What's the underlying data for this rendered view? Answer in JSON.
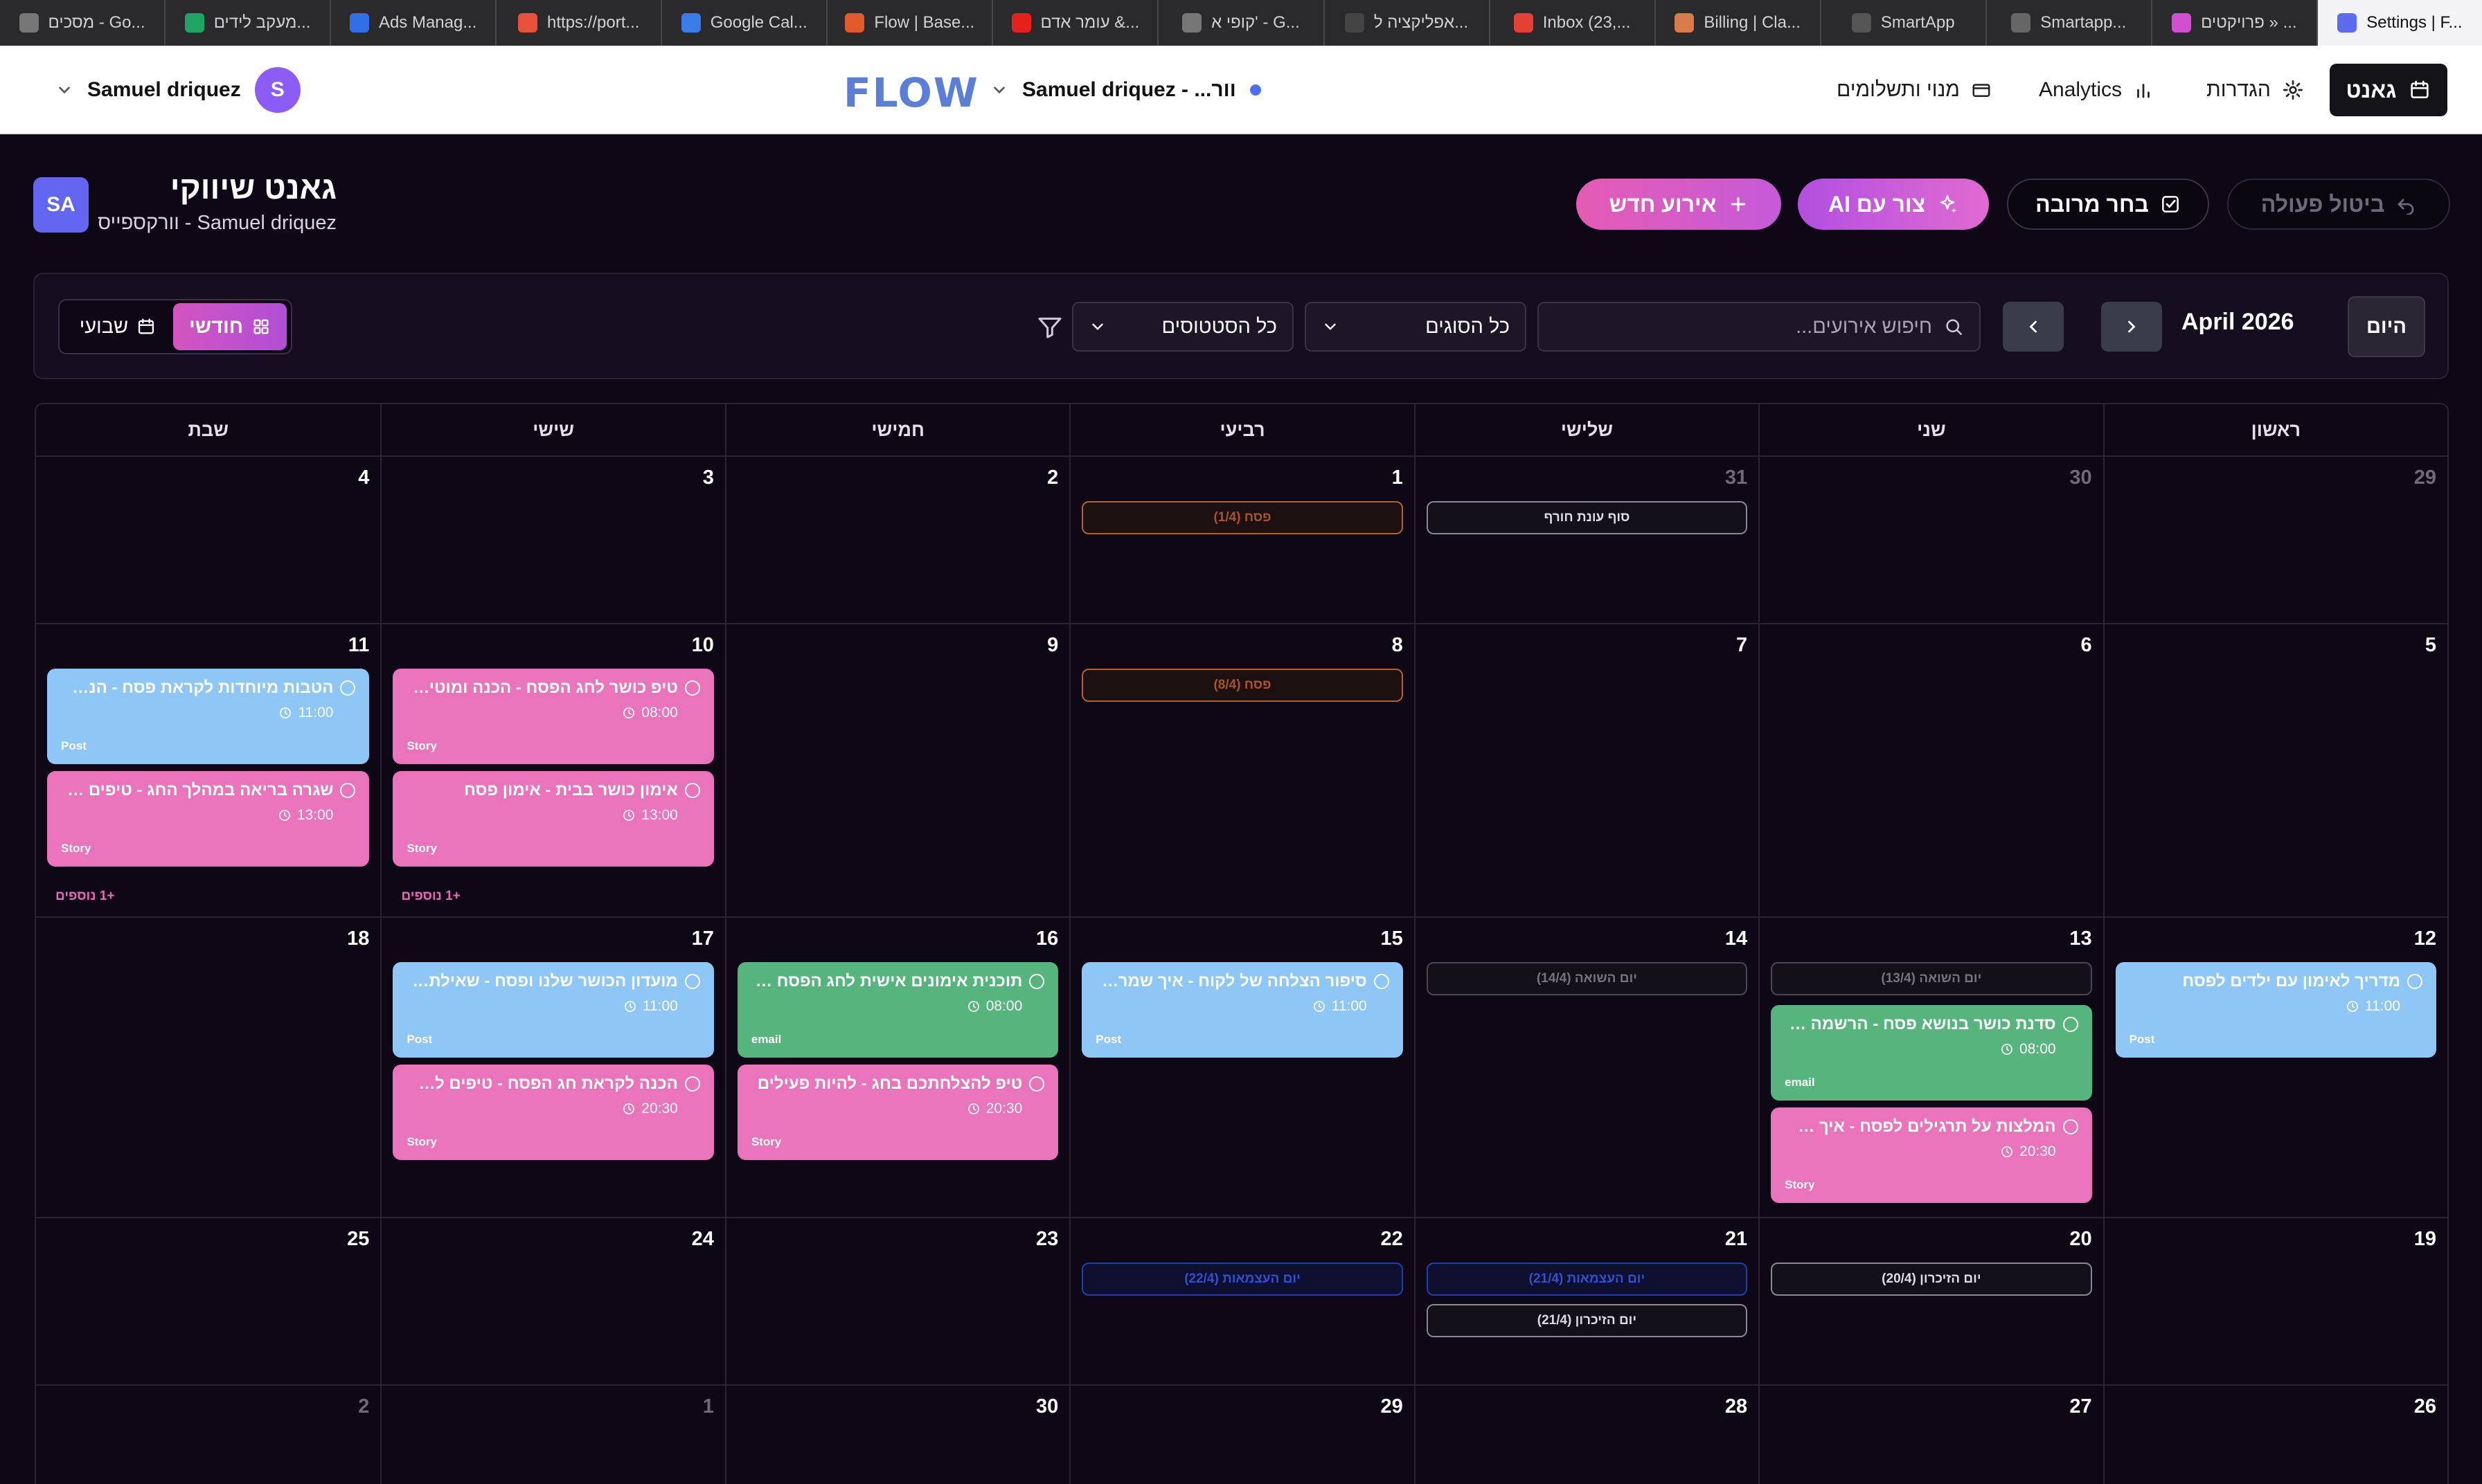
{
  "browser_tabs": [
    {
      "label": "Settings | F...",
      "icon": "flow-favicon",
      "color": "#5b6cf0",
      "active": true
    },
    {
      "label": "פרויקטים » ...",
      "icon": "w-favicon",
      "color": "#d24fd0"
    },
    {
      "label": "Smartapp...",
      "icon": "compass-icon",
      "color": "#666666"
    },
    {
      "label": "SmartApp",
      "icon": "arrow-icon",
      "color": "#555555"
    },
    {
      "label": "Billing | Cla...",
      "icon": "claude-favicon",
      "color": "#d87a4a"
    },
    {
      "label": "Inbox (23,...",
      "icon": "gmail-favicon",
      "color": "#e34133"
    },
    {
      "label": "אפליקציה ל...",
      "icon": "openai-favicon",
      "color": "#444444"
    },
    {
      "label": "קופי א' - G...",
      "icon": "g-favicon",
      "color": "#777777"
    },
    {
      "label": "עומר אדם &...",
      "icon": "youtube-favicon",
      "color": "#e8201c"
    },
    {
      "label": "Flow | Base...",
      "icon": "flow-base-favicon",
      "color": "#e05a2a"
    },
    {
      "label": "Google Cal...",
      "icon": "calendar-favicon",
      "color": "#3a7de8"
    },
    {
      "label": "https://port...",
      "icon": "pocket-favicon",
      "color": "#e8503c"
    },
    {
      "label": "Ads Manag...",
      "icon": "meta-favicon",
      "color": "#2f6fe8"
    },
    {
      "label": "מעקב לידים...",
      "icon": "sheets-favicon",
      "color": "#1fa463"
    },
    {
      "label": "מסכים - Go...",
      "icon": "g-favicon",
      "color": "#777777"
    }
  ],
  "appbar": {
    "user_name": "Samuel driquez",
    "user_initial": "S",
    "logo": "FLOW",
    "workspace_label": "Samuel driquez - ...וור",
    "nav_billing": "מנוי ותשלומים",
    "nav_analytics": "Analytics",
    "nav_settings": "הגדרות",
    "gantt_button": "גאנט"
  },
  "page": {
    "avatar": "SA",
    "title": "גאנט שיווקי",
    "subtitle": "Samuel driquez - וורקספייס",
    "btn_new_event": "אירוע חדש",
    "btn_ai": "צור עם AI",
    "btn_multi_select": "בחר מרובה",
    "btn_undo": "ביטול פעולה"
  },
  "toolbar": {
    "view_month": "חודשי",
    "view_week": "שבועי",
    "status_filter": "כל הסטטוסים",
    "type_filter": "כל הסוגים",
    "search_placeholder": "חיפוש אירועים...",
    "month_label": "April 2026",
    "today": "היום"
  },
  "calendar": {
    "weekdays": [
      "ראשון",
      "שני",
      "שלישי",
      "רביעי",
      "חמישי",
      "שישי",
      "שבת"
    ],
    "weeks": [
      [
        {
          "day": "29",
          "out": true
        },
        {
          "day": "30",
          "out": true
        },
        {
          "day": "31",
          "out": true,
          "holidays": [
            {
              "label": "סוף עונת חורף",
              "style": "gray"
            }
          ]
        },
        {
          "day": "1",
          "holidays": [
            {
              "label": "פסח (1/4)",
              "style": "orange"
            }
          ]
        },
        {
          "day": "2"
        },
        {
          "day": "3"
        },
        {
          "day": "4"
        }
      ],
      [
        {
          "day": "5"
        },
        {
          "day": "6"
        },
        {
          "day": "7"
        },
        {
          "day": "8",
          "holidays": [
            {
              "label": "פסח (8/4)",
              "style": "orange"
            }
          ]
        },
        {
          "day": "9"
        },
        {
          "day": "10",
          "events": [
            {
              "title": "טיפ כושר לחג הפסח - הכנה ומוטיבציה",
              "time": "08:00",
              "type": "Story",
              "color": "pink"
            },
            {
              "title": "אימון כושר בבית - אימון פסח",
              "time": "13:00",
              "type": "Story",
              "color": "pink"
            }
          ],
          "more": "+1 נוספים"
        },
        {
          "day": "11",
          "events": [
            {
              "title": "הטבות מיוחדות לקראת פסח - הנחה ע...",
              "time": "11:00",
              "type": "Post",
              "color": "blue"
            },
            {
              "title": "שגרה בריאה במהלך החג - טיפים באי...",
              "time": "13:00",
              "type": "Story",
              "color": "pink"
            }
          ],
          "more": "+1 נוספים"
        }
      ],
      [
        {
          "day": "12",
          "events": [
            {
              "title": "מדריך לאימון עם ילדים לפסח",
              "time": "11:00",
              "type": "Post",
              "color": "blue"
            }
          ]
        },
        {
          "day": "13",
          "holidays": [
            {
              "label": "יום השואה (13/4)",
              "style": "dim"
            }
          ],
          "events": [
            {
              "title": "סדנת כושר בנושא פסח - הרשמה פתו...",
              "time": "08:00",
              "type": "email",
              "color": "green"
            },
            {
              "title": "המלצות על תרגילים לפסח - איך להי...",
              "time": "20:30",
              "type": "Story",
              "color": "pink"
            }
          ]
        },
        {
          "day": "14",
          "holidays": [
            {
              "label": "יום השואה (14/4)",
              "style": "dim"
            }
          ]
        },
        {
          "day": "15",
          "events": [
            {
              "title": "סיפור הצלחה של לקוח - איך שמרתי ...",
              "time": "11:00",
              "type": "Post",
              "color": "blue"
            }
          ]
        },
        {
          "day": "16",
          "events": [
            {
              "title": "תוכנית אימונים אישית לחג הפסח - ע...",
              "time": "08:00",
              "type": "email",
              "color": "green"
            },
            {
              "title": "טיפ להצלחתכם בחג - להיות פעילים",
              "time": "20:30",
              "type": "Story",
              "color": "pink"
            }
          ]
        },
        {
          "day": "17",
          "events": [
            {
              "title": "מועדון הכושר שלנו ופסח - שאילתא ...",
              "time": "11:00",
              "type": "Post",
              "color": "blue"
            },
            {
              "title": "הכנה לקראת חג הפסח - טיפים לתזו...",
              "time": "20:30",
              "type": "Story",
              "color": "pink"
            }
          ]
        },
        {
          "day": "18"
        }
      ],
      [
        {
          "day": "19"
        },
        {
          "day": "20",
          "holidays": [
            {
              "label": "יום הזיכרון (20/4)",
              "style": "gray"
            }
          ]
        },
        {
          "day": "21",
          "holidays": [
            {
              "label": "יום העצמאות (21/4)",
              "style": "blue"
            },
            {
              "label": "יום הזיכרון (21/4)",
              "style": "gray"
            }
          ]
        },
        {
          "day": "22",
          "holidays": [
            {
              "label": "יום העצמאות (22/4)",
              "style": "blue"
            }
          ]
        },
        {
          "day": "23"
        },
        {
          "day": "24"
        },
        {
          "day": "25"
        }
      ],
      [
        {
          "day": "26"
        },
        {
          "day": "27"
        },
        {
          "day": "28"
        },
        {
          "day": "29"
        },
        {
          "day": "30"
        },
        {
          "day": "1",
          "out": true
        },
        {
          "day": "2",
          "out": true
        }
      ]
    ]
  }
}
